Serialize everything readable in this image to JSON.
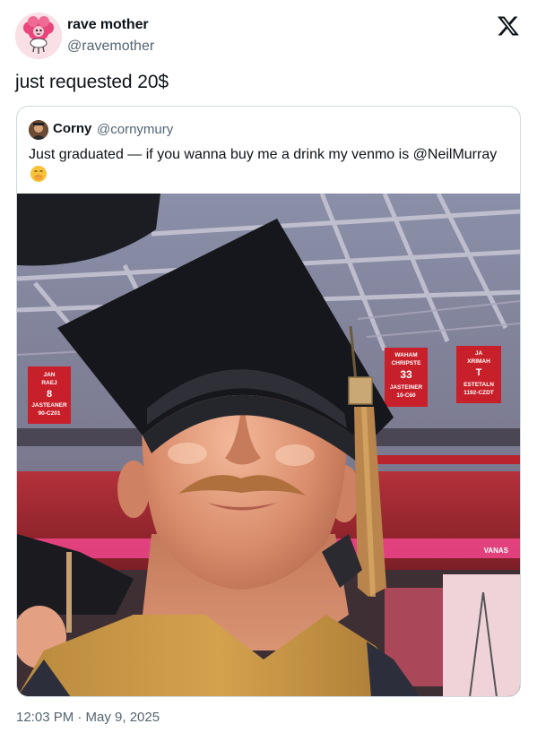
{
  "author": {
    "name": "rave mother",
    "handle": "@ravemother",
    "avatar_icon": "pink-flower-character-avatar"
  },
  "platform_icon": "x-logo-icon",
  "tweet": {
    "text": "just requested 20$",
    "timestamp": "12:03 PM · May 9, 2025"
  },
  "quoted_tweet": {
    "name": "Corny",
    "handle": "@cornymury",
    "text": "Just graduated — if you wanna buy me a drink my venmo is @NeilMurray",
    "emoji_icon": "hand-over-mouth-emoji-icon",
    "photo": {
      "description_icon": "graduate-selfie-photo",
      "banners": [
        {
          "lines": [
            "JAN",
            "RAEJ",
            "8",
            "JASTEANER",
            "90-C201"
          ]
        },
        {
          "lines": [
            "WAHAM",
            "CHRIPSTE",
            "33",
            "JASTEINER",
            "10-C60"
          ]
        },
        {
          "lines": [
            "JA",
            "XRIMAH",
            "T",
            "ESTETALN",
            "1192-CZDT"
          ]
        }
      ],
      "arena_sign": "VANAS"
    }
  },
  "colors": {
    "text": "#0f1419",
    "secondary": "#536471",
    "border": "#cfd9de",
    "banner_red": "#c8202a"
  }
}
